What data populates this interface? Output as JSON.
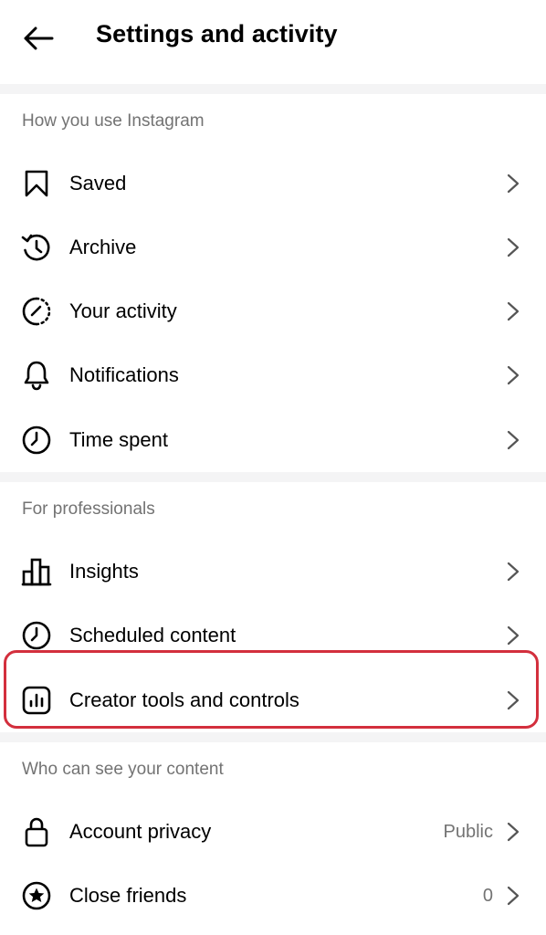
{
  "header": {
    "title": "Settings and activity",
    "back_icon": "arrow-left-icon"
  },
  "sections": {
    "usage": {
      "title": "How you use Instagram",
      "items": [
        {
          "label": "Saved",
          "icon": "bookmark-icon"
        },
        {
          "label": "Archive",
          "icon": "archive-history-icon"
        },
        {
          "label": "Your activity",
          "icon": "activity-icon"
        },
        {
          "label": "Notifications",
          "icon": "bell-icon"
        },
        {
          "label": "Time spent",
          "icon": "clock-icon"
        }
      ]
    },
    "professionals": {
      "title": "For professionals",
      "items": [
        {
          "label": "Insights",
          "icon": "bar-chart-icon"
        },
        {
          "label": "Scheduled content",
          "icon": "clock-icon"
        },
        {
          "label": "Creator tools and controls",
          "icon": "creator-tools-icon"
        }
      ]
    },
    "visibility": {
      "title": "Who can see your content",
      "items": [
        {
          "label": "Account privacy",
          "value": "Public",
          "icon": "lock-icon"
        },
        {
          "label": "Close friends",
          "value": "0",
          "icon": "star-circle-icon"
        }
      ]
    }
  },
  "colors": {
    "highlight": "#d32f3d",
    "secondary_text": "#737373",
    "section_gap": "#f4f4f5"
  }
}
